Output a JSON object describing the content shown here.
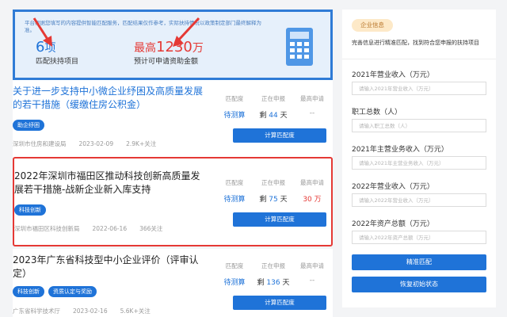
{
  "banner": {
    "notice": "平台根据您填写的内容提供智能匹配服务，匹配结果仅作参考，实际扶持情况以政策制定部门最终解释为准。",
    "projects_count": "6",
    "projects_unit": "项",
    "projects_label": "匹配扶持项目",
    "max_prefix": "最高",
    "max_amount": "1230",
    "max_unit": "万",
    "max_label": "预计可申请资助金额"
  },
  "columns": {
    "match": "匹配度",
    "applying": "正在申报",
    "max": "最高申请"
  },
  "policies": [
    {
      "title": "关于进一步支持中小微企业纾困及高质量发展的若干措施（缓缴住房公积金）",
      "tags": [
        "助企纾困"
      ],
      "department": "深圳市住房和建设局",
      "date": "2023-02-09",
      "followers": "2.9K+关注",
      "match": "待测算",
      "applying_prefix": "剩",
      "applying_days": "44",
      "applying_unit": "天",
      "max": "--",
      "button": "计算匹配度"
    },
    {
      "title": "2022年深圳市福田区推动科技创新高质量发展若干措施-战新企业新入库支持",
      "tags": [
        "科技创新"
      ],
      "department": "深圳市福田区科技创新局",
      "date": "2022-06-16",
      "followers": "366关注",
      "match": "待测算",
      "applying_prefix": "剩",
      "applying_days": "75",
      "applying_unit": "天",
      "max": "30 万",
      "button": "计算匹配度"
    },
    {
      "title": "2023年广东省科技型中小企业评价（评审认定）",
      "tags": [
        "科技创新",
        "资质认定与奖励"
      ],
      "department": "广东省科学技术厅",
      "date": "2023-02-16",
      "followers": "5.6K+关注",
      "match": "待测算",
      "applying_prefix": "剩",
      "applying_days": "136",
      "applying_unit": "天",
      "max": "--",
      "button": "计算匹配度"
    }
  ],
  "panel": {
    "tag": "企业信息",
    "description": "完善信息进行精准匹配，找到符合您申报的扶持项目",
    "fields": [
      {
        "label": "2021年营业收入（万元）",
        "placeholder": "请输入2021年营业收入（万元）",
        "value": ""
      },
      {
        "label": "职工总数（人）",
        "placeholder": "请输入职工总数（人）",
        "value": ""
      },
      {
        "label": "2021年主营业务收入（万元）",
        "placeholder": "请输入2021年主营业务收入（万元）",
        "value": ""
      },
      {
        "label": "2022年营业收入（万元）",
        "placeholder": "请输入2022年营业收入（万元）",
        "value": ""
      },
      {
        "label": "2022年资产总额（万元）",
        "placeholder": "请输入2022年资产总额（万元）",
        "value": ""
      }
    ],
    "match_button": "精准匹配",
    "reset_button": "恢复初始状态"
  },
  "colors": {
    "primary": "#1f73d8",
    "highlight": "#e53935",
    "tag_bg": "#fde9c8",
    "tag_text": "#b9772c"
  }
}
